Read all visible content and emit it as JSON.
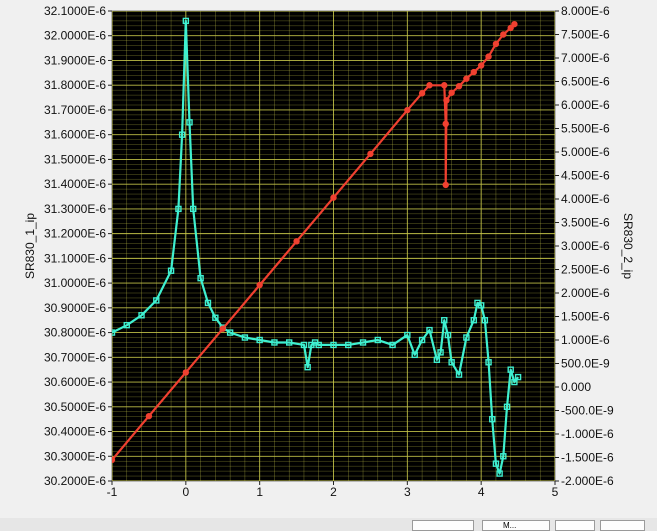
{
  "chart_data": {
    "type": "line",
    "plot_background": "#000000",
    "grid": true,
    "grid_color": "#c8c84a",
    "x": {
      "label": "",
      "range": [
        -1,
        5
      ],
      "ticks": [
        -1,
        0,
        1,
        2,
        3,
        4,
        5
      ],
      "tick_labels": [
        "-1",
        "0",
        "1",
        "2",
        "3",
        "4",
        "5"
      ]
    },
    "y_left": {
      "label": "SR830_1_ip",
      "range": [
        3.02e-05,
        3.21e-05
      ],
      "ticks": [
        3.02e-05,
        3.03e-05,
        3.04e-05,
        3.05e-05,
        3.06e-05,
        3.07e-05,
        3.08e-05,
        3.09e-05,
        3.1e-05,
        3.11e-05,
        3.12e-05,
        3.13e-05,
        3.14e-05,
        3.15e-05,
        3.16e-05,
        3.17e-05,
        3.18e-05,
        3.19e-05,
        3.2e-05,
        3.21e-05
      ],
      "tick_labels": [
        "30.2000E-6",
        "30.3000E-6",
        "30.4000E-6",
        "30.5000E-6",
        "30.6000E-6",
        "30.7000E-6",
        "30.8000E-6",
        "30.9000E-6",
        "31.0000E-6",
        "31.1000E-6",
        "31.2000E-6",
        "31.3000E-6",
        "31.4000E-6",
        "31.5000E-6",
        "31.6000E-6",
        "31.7000E-6",
        "31.8000E-6",
        "31.9000E-6",
        "32.0000E-6",
        "32.1000E-6"
      ]
    },
    "y_right": {
      "label": "SR830_2_ip",
      "range": [
        -2e-06,
        8e-06
      ],
      "ticks": [
        -2e-06,
        -1.5e-06,
        -1e-06,
        -5e-07,
        0,
        5e-07,
        1e-06,
        1.5e-06,
        2e-06,
        2.5e-06,
        3e-06,
        3.5e-06,
        4e-06,
        4.5e-06,
        5e-06,
        5.5e-06,
        6e-06,
        6.5e-06,
        7e-06,
        7.5e-06,
        8e-06
      ],
      "tick_labels": [
        "-2.000E-6",
        "-1.500E-6",
        "-1.000E-6",
        "-500.0E-9",
        "0.000",
        "500.0E-9",
        "1.000E-6",
        "1.500E-6",
        "2.000E-6",
        "2.500E-6",
        "3.000E-6",
        "3.500E-6",
        "4.000E-6",
        "4.500E-6",
        "5.000E-6",
        "5.500E-6",
        "6.000E-6",
        "6.500E-6",
        "7.000E-6",
        "7.500E-6",
        "8.000E-6"
      ]
    },
    "series": [
      {
        "axis": "left",
        "color": "#3ff0d0",
        "marker": "square",
        "x": [
          -1.0,
          -0.8,
          -0.6,
          -0.4,
          -0.2,
          -0.1,
          -0.05,
          0.0,
          0.05,
          0.1,
          0.2,
          0.3,
          0.4,
          0.5,
          0.6,
          0.8,
          1.0,
          1.2,
          1.4,
          1.6,
          1.65,
          1.7,
          1.75,
          1.8,
          2.0,
          2.2,
          2.4,
          2.6,
          2.8,
          3.0,
          3.1,
          3.2,
          3.3,
          3.4,
          3.45,
          3.5,
          3.55,
          3.6,
          3.7,
          3.8,
          3.9,
          3.95,
          4.0,
          4.05,
          4.1,
          4.15,
          4.2,
          4.25,
          4.3,
          4.35,
          4.4,
          4.45,
          4.5
        ],
        "y": [
          3.08e-05,
          3.083e-05,
          3.087e-05,
          3.093e-05,
          3.105e-05,
          3.13e-05,
          3.16e-05,
          3.206e-05,
          3.165e-05,
          3.13e-05,
          3.102e-05,
          3.092e-05,
          3.086e-05,
          3.082e-05,
          3.08e-05,
          3.078e-05,
          3.077e-05,
          3.076e-05,
          3.076e-05,
          3.075e-05,
          3.066e-05,
          3.075e-05,
          3.076e-05,
          3.075e-05,
          3.075e-05,
          3.075e-05,
          3.076e-05,
          3.077e-05,
          3.075e-05,
          3.079e-05,
          3.071e-05,
          3.077e-05,
          3.081e-05,
          3.069e-05,
          3.072e-05,
          3.085e-05,
          3.079e-05,
          3.068e-05,
          3.063e-05,
          3.078e-05,
          3.085e-05,
          3.092e-05,
          3.091e-05,
          3.085e-05,
          3.068e-05,
          3.045e-05,
          3.027e-05,
          3.023e-05,
          3.03e-05,
          3.05e-05,
          3.065e-05,
          3.06e-05,
          3.062e-05
        ]
      },
      {
        "axis": "right",
        "color": "#f04030",
        "marker": "circle",
        "x": [
          -1.0,
          -0.5,
          0.0,
          0.5,
          1.0,
          1.5,
          2.0,
          2.5,
          3.0,
          3.2,
          3.3,
          3.5,
          3.52,
          3.52,
          3.53,
          3.6,
          3.7,
          3.8,
          3.9,
          4.0,
          4.1,
          4.2,
          4.3,
          4.4,
          4.45
        ],
        "y": [
          -1.55e-06,
          -6.2e-07,
          3.1e-07,
          1.24e-06,
          2.17e-06,
          3.1e-06,
          4.03e-06,
          4.96e-06,
          5.89e-06,
          6.25e-06,
          6.42e-06,
          6.42e-06,
          5.6e-06,
          4.3e-06,
          6.1e-06,
          6.26e-06,
          6.4e-06,
          6.56e-06,
          6.7e-06,
          6.84e-06,
          7.03e-06,
          7.3e-06,
          7.5e-06,
          7.64e-06,
          7.72e-06
        ]
      }
    ]
  },
  "bottom_bar": {
    "button_label": "M..."
  }
}
